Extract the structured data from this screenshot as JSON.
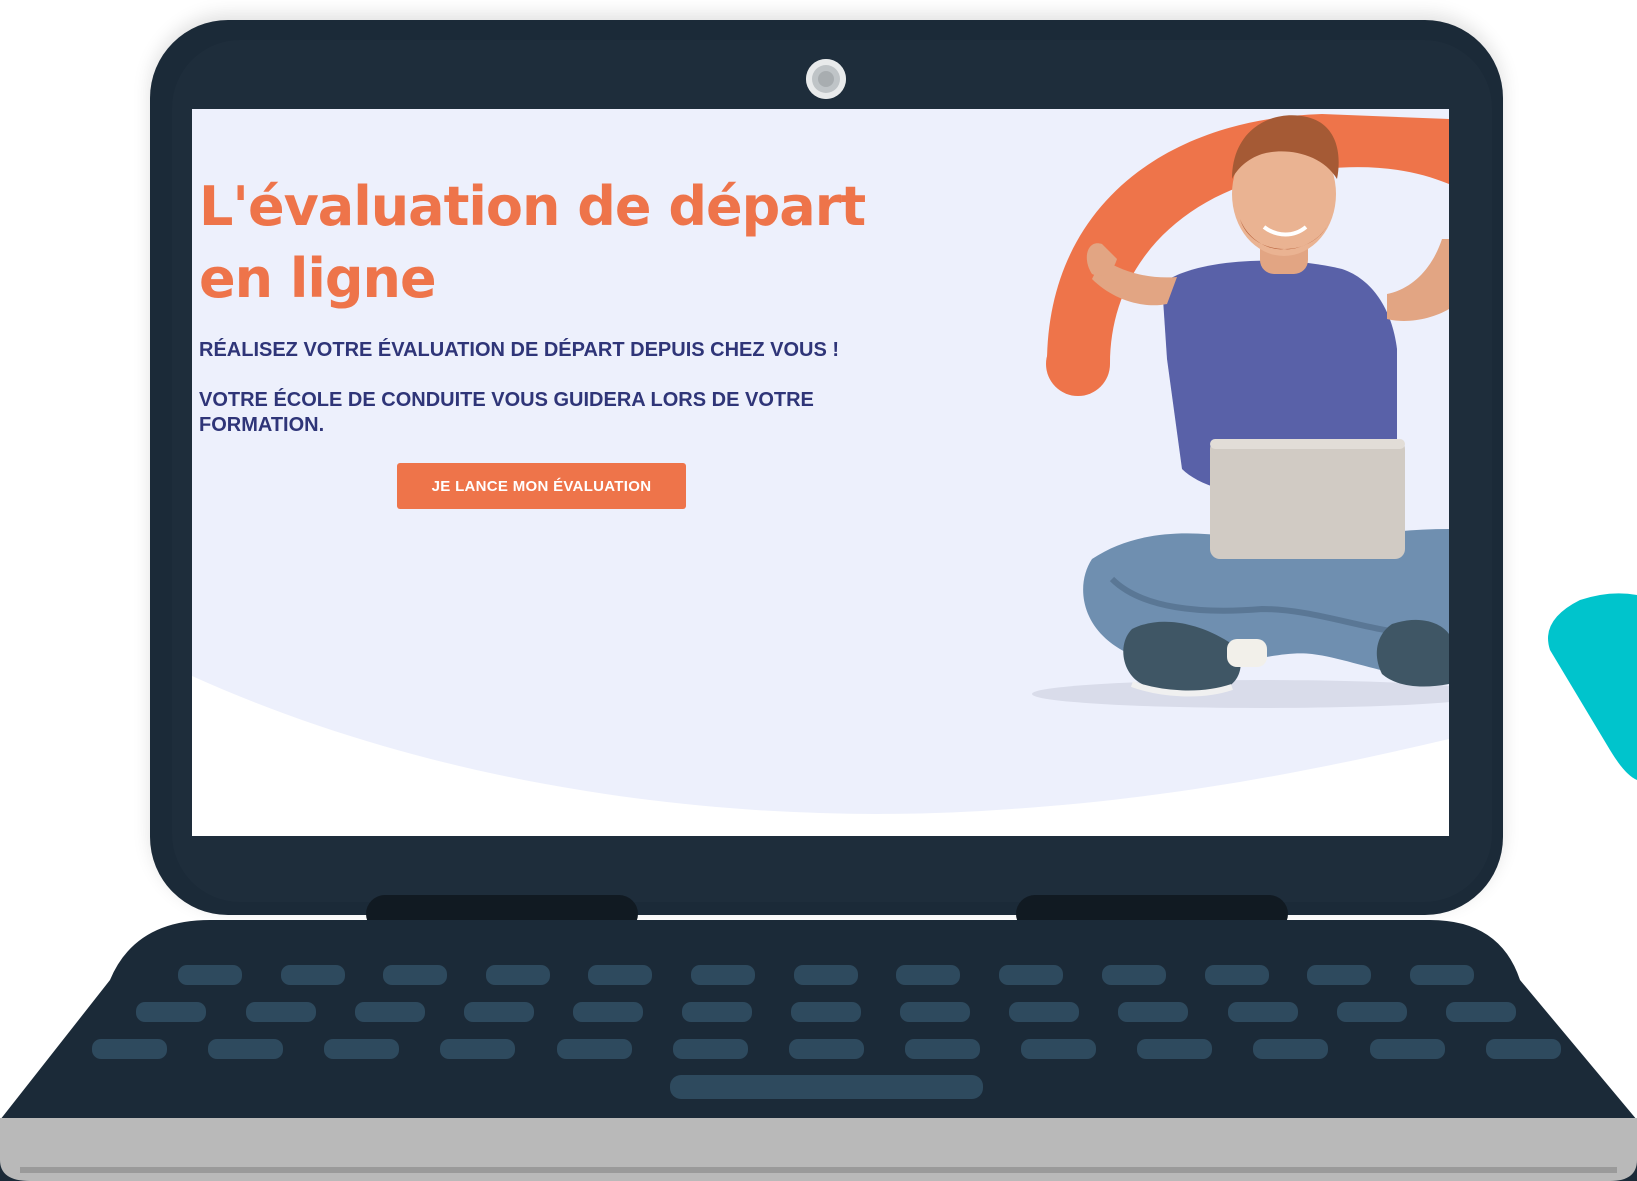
{
  "hero": {
    "title": "L'évaluation de départ en ligne",
    "subtitle_1": "RÉALISEZ VOTRE ÉVALUATION DE DÉPART DEPUIS CHEZ VOUS !",
    "subtitle_2": "VOTRE ÉCOLE DE CONDUITE VOUS GUIDERA LORS DE VOTRE FORMATION.",
    "cta_label": "JE LANCE MON ÉVALUATION"
  },
  "colors": {
    "accent": "#ee744a",
    "text_primary": "#2f3578",
    "screen_bg": "#edf0fc",
    "laptop_body": "#1b2a38",
    "key": "#2e4a5e",
    "teal": "#00c4cc"
  },
  "icons": {
    "camera": "webcam-icon"
  }
}
